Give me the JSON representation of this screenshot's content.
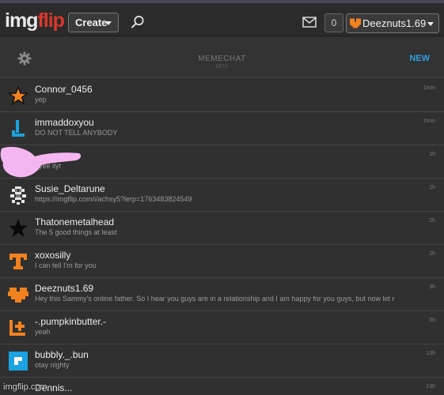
{
  "header": {
    "logo_main": "img",
    "logo_accent": "flip",
    "create_label": "Create",
    "notification_count": "0",
    "username": "Deeznuts1.69"
  },
  "chat": {
    "title": "MEMECHAT",
    "beta": "BETA",
    "new_label": "NEW"
  },
  "conversations": [
    {
      "name": "Connor_0456",
      "preview": "yep",
      "time": "1min"
    },
    {
      "name": "immaddoxyou",
      "preview": "DO NOT TELL ANYBODY",
      "time": "2min"
    },
    {
      "name": "",
      "preview": "byee ilyt",
      "time": "1h"
    },
    {
      "name": "Susie_Deltarune",
      "preview": "https://imgflip.com/i/achsy5?lerp=1763483824549",
      "time": "1h"
    },
    {
      "name": "Thatonemetalhead",
      "preview": "The 5 good things at least",
      "time": "2h"
    },
    {
      "name": "xoxosilly",
      "preview": "I can tell I'm for you",
      "time": "2h"
    },
    {
      "name": "Deeznuts1.69",
      "preview": "Hey this Sammy's online father. So I hear you guys are in a relationship and I am happy for you guys, but now let r",
      "time": "3h"
    },
    {
      "name": "-.pumpkinbutter.-",
      "preview": "yeah",
      "time": "5h"
    },
    {
      "name": "bubbly._.bun",
      "preview": "otay nighty",
      "time": "13h"
    },
    {
      "name": "Dennis...",
      "preview": "",
      "time": "13h"
    }
  ],
  "watermark": "imgflip.com",
  "colors": {
    "accent_red": "#d8392b",
    "link_blue": "#2f9fe0",
    "avatar_orange": "#f0821f",
    "avatar_blue": "#1aa3e0",
    "redaction_pink": "#f4b6f0"
  }
}
